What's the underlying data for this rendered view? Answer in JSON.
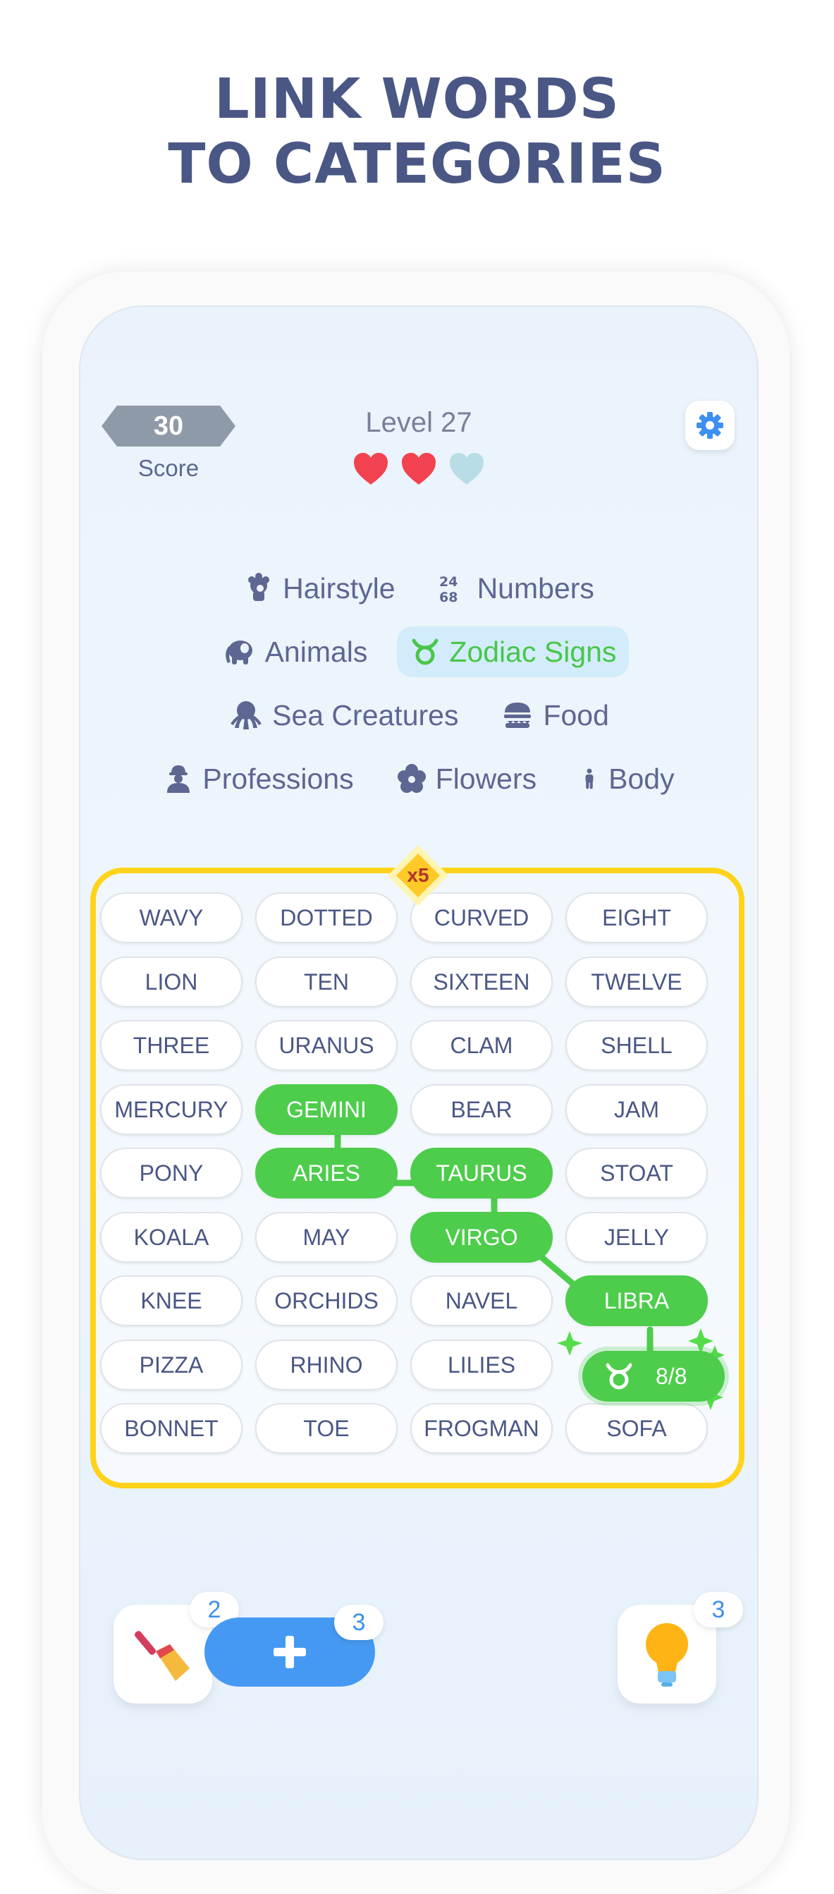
{
  "headline": {
    "line1": "LINK WORDS",
    "line2": "TO CATEGORIES"
  },
  "top_bar": {
    "score": "30",
    "score_label": "Score",
    "level": "Level 27",
    "lives": {
      "total": 3,
      "remaining": 2
    },
    "settings_icon": "gear-icon"
  },
  "categories": [
    {
      "label": "Hairstyle",
      "icon": "hairstyle-icon"
    },
    {
      "label": "Numbers",
      "icon": "numbers-icon"
    },
    {
      "label": "Animals",
      "icon": "elephant-icon"
    },
    {
      "label": "Zodiac Signs",
      "icon": "taurus-icon",
      "active": true
    },
    {
      "label": "Sea Creatures",
      "icon": "octopus-icon"
    },
    {
      "label": "Food",
      "icon": "burger-icon"
    },
    {
      "label": "Professions",
      "icon": "worker-icon"
    },
    {
      "label": "Flowers",
      "icon": "flower-icon"
    },
    {
      "label": "Body",
      "icon": "person-icon"
    }
  ],
  "multiplier": "x5",
  "grid": [
    [
      "WAVY",
      "DOTTED",
      "CURVED",
      "EIGHT"
    ],
    [
      "LION",
      "TEN",
      "SIXTEEN",
      "TWELVE"
    ],
    [
      "THREE",
      "URANUS",
      "CLAM",
      "SHELL"
    ],
    [
      "MERCURY",
      "GEMINI",
      "BEAR",
      "JAM"
    ],
    [
      "PONY",
      "ARIES",
      "TAURUS",
      "STOAT"
    ],
    [
      "KOALA",
      "MAY",
      "VIRGO",
      "JELLY"
    ],
    [
      "KNEE",
      "ORCHIDS",
      "NAVEL",
      "LIBRA"
    ],
    [
      "PIZZA",
      "RHINO",
      "LILIES",
      ""
    ],
    [
      "BONNET",
      "TOE",
      "FROGMAN",
      "SOFA"
    ]
  ],
  "selected_words": [
    "GEMINI",
    "ARIES",
    "TAURUS",
    "VIRGO",
    "LIBRA"
  ],
  "progress_pill": {
    "icon": "taurus-icon",
    "text": "8/8"
  },
  "tools": {
    "brush": {
      "icon": "brush-icon",
      "count": "2"
    },
    "add": {
      "icon": "plus-icon",
      "count": "3"
    },
    "hint": {
      "icon": "lightbulb-icon",
      "count": "3"
    }
  },
  "colors": {
    "accent_green": "#4dcd4b",
    "title": "#4a5785",
    "border_gold": "#ffd31a",
    "blue": "#4699f2"
  }
}
